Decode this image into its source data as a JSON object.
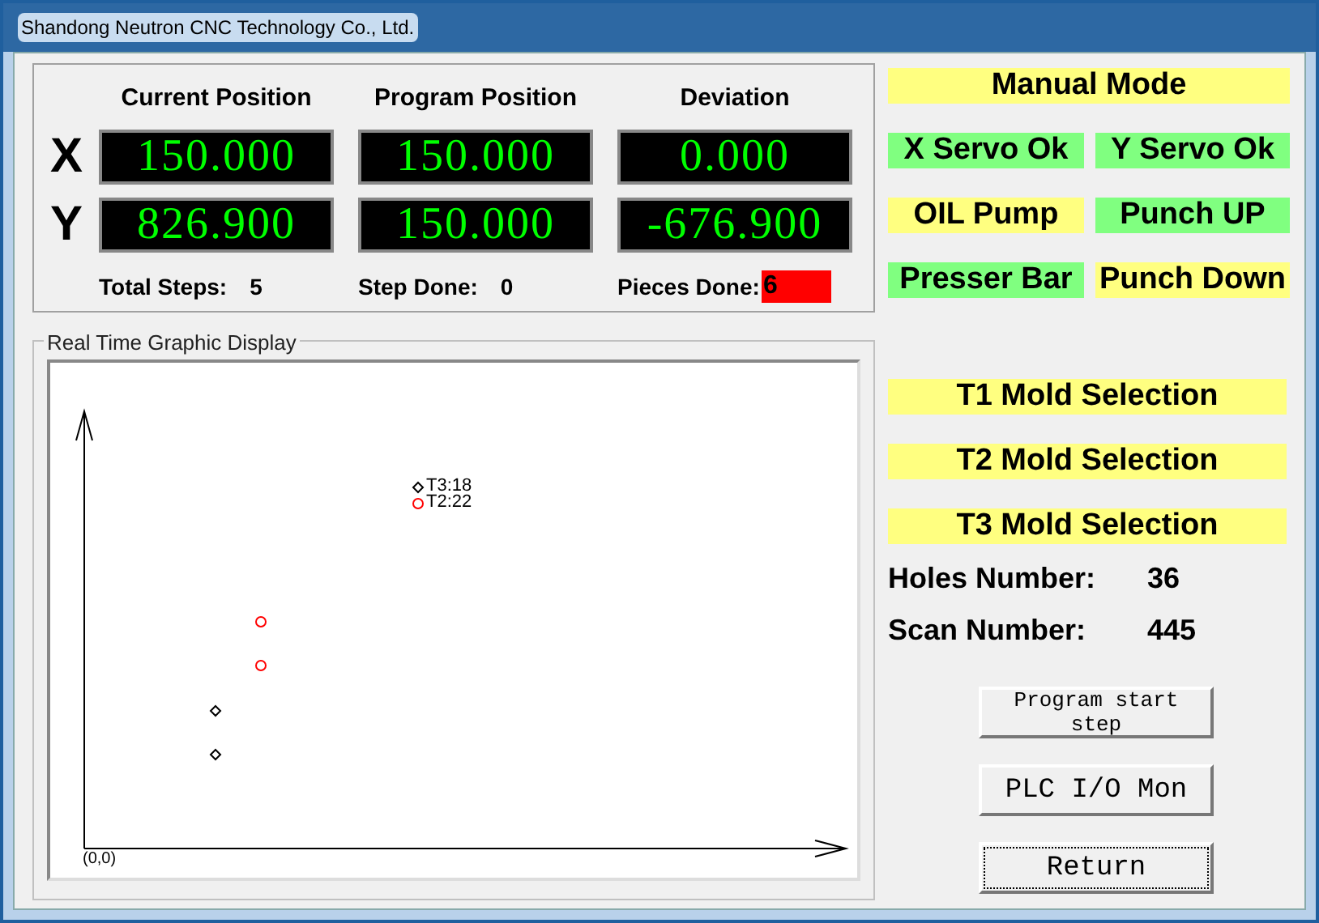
{
  "window": {
    "title": "Shandong Neutron CNC Technology Co., Ltd."
  },
  "positions": {
    "headers": [
      "Current Position",
      "Program Position",
      "Deviation"
    ],
    "rows": [
      {
        "axis": "X",
        "values": [
          "150.000",
          "150.000",
          "0.000"
        ]
      },
      {
        "axis": "Y",
        "values": [
          "826.900",
          "150.000",
          "-676.900"
        ]
      }
    ]
  },
  "counters": [
    {
      "label": "Total Steps:",
      "value": "5",
      "kind": "plain"
    },
    {
      "label": "Step Done:",
      "value": "0",
      "kind": "plain"
    },
    {
      "label": "Pieces Done:",
      "value": "6",
      "kind": "alert"
    }
  ],
  "graphic_display": {
    "title": "Real Time Graphic Display",
    "origin_label": "(0,0)",
    "marks": [
      {
        "kind": "diamond",
        "label": "T3:18"
      },
      {
        "kind": "circle",
        "label": "T2:22"
      },
      {
        "kind": "circle"
      },
      {
        "kind": "circle"
      },
      {
        "kind": "diamond"
      },
      {
        "kind": "diamond"
      }
    ]
  },
  "mode": {
    "label": "Manual Mode",
    "on": false
  },
  "indicators": [
    {
      "label": "X Servo Ok",
      "on": true
    },
    {
      "label": "Y Servo Ok",
      "on": true
    },
    {
      "label": "OIL Pump",
      "on": false
    },
    {
      "label": "Punch UP",
      "on": true
    },
    {
      "label": "Presser Bar",
      "on": true
    },
    {
      "label": "Punch Down",
      "on": false
    }
  ],
  "molds": [
    {
      "label": "T1 Mold Selection",
      "on": false
    },
    {
      "label": "T2 Mold Selection",
      "on": false
    },
    {
      "label": "T3 Mold Selection",
      "on": false
    }
  ],
  "stats": [
    {
      "label": "Holes Number:",
      "value": "36"
    },
    {
      "label": "Scan Number:",
      "value": "445"
    }
  ],
  "buttons": [
    {
      "label": "Program start step",
      "focused": false
    },
    {
      "label": "PLC I/O Mon",
      "focused": false
    },
    {
      "label": "Return",
      "focused": true
    }
  ]
}
